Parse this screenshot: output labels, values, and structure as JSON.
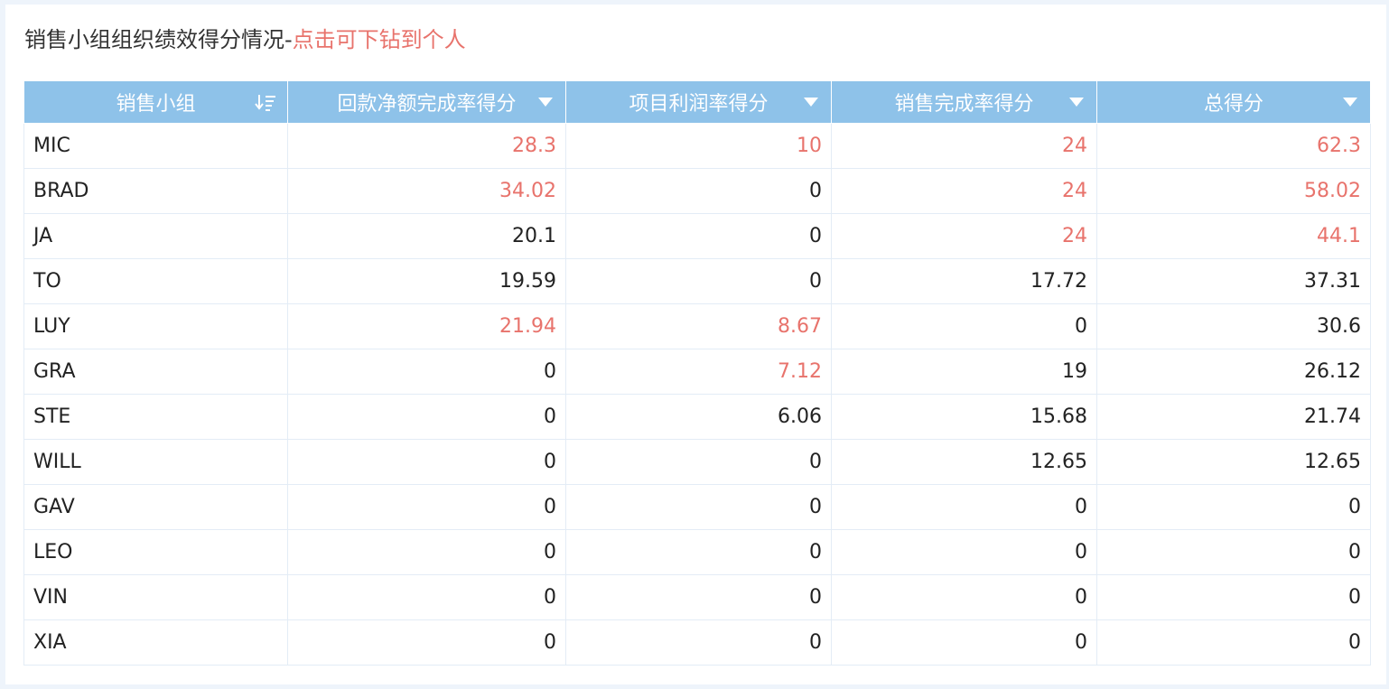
{
  "title": {
    "main": "销售小组组织绩效得分情况-",
    "hint": "点击可下钻到个人"
  },
  "colors": {
    "header_bg": "#8ec2e9",
    "highlight": "#e8736c"
  },
  "table": {
    "columns": [
      {
        "label": "销售小组",
        "icon": "sort-icon"
      },
      {
        "label": "回款净额完成率得分",
        "icon": "dropdown-icon"
      },
      {
        "label": "项目利润率得分",
        "icon": "dropdown-icon"
      },
      {
        "label": "销售完成率得分",
        "icon": "dropdown-icon"
      },
      {
        "label": "总得分",
        "icon": "dropdown-icon"
      }
    ],
    "rows": [
      {
        "name": "MIC",
        "values": [
          "28.3",
          "10",
          "24",
          "62.3"
        ],
        "highlight": [
          true,
          true,
          true,
          true
        ]
      },
      {
        "name": "BRAD",
        "values": [
          "34.02",
          "0",
          "24",
          "58.02"
        ],
        "highlight": [
          true,
          false,
          true,
          true
        ]
      },
      {
        "name": "JA",
        "values": [
          "20.1",
          "0",
          "24",
          "44.1"
        ],
        "highlight": [
          false,
          false,
          true,
          true
        ]
      },
      {
        "name": "TO",
        "values": [
          "19.59",
          "0",
          "17.72",
          "37.31"
        ],
        "highlight": [
          false,
          false,
          false,
          false
        ]
      },
      {
        "name": "LUY",
        "values": [
          "21.94",
          "8.67",
          "0",
          "30.6"
        ],
        "highlight": [
          true,
          true,
          false,
          false
        ]
      },
      {
        "name": "GRA",
        "values": [
          "0",
          "7.12",
          "19",
          "26.12"
        ],
        "highlight": [
          false,
          true,
          false,
          false
        ]
      },
      {
        "name": "STE",
        "values": [
          "0",
          "6.06",
          "15.68",
          "21.74"
        ],
        "highlight": [
          false,
          false,
          false,
          false
        ]
      },
      {
        "name": "WILL",
        "values": [
          "0",
          "0",
          "12.65",
          "12.65"
        ],
        "highlight": [
          false,
          false,
          false,
          false
        ]
      },
      {
        "name": "GAV",
        "values": [
          "0",
          "0",
          "0",
          "0"
        ],
        "highlight": [
          false,
          false,
          false,
          false
        ]
      },
      {
        "name": "LEO",
        "values": [
          "0",
          "0",
          "0",
          "0"
        ],
        "highlight": [
          false,
          false,
          false,
          false
        ]
      },
      {
        "name": "VIN",
        "values": [
          "0",
          "0",
          "0",
          "0"
        ],
        "highlight": [
          false,
          false,
          false,
          false
        ]
      },
      {
        "name": "XIA",
        "values": [
          "0",
          "0",
          "0",
          "0"
        ],
        "highlight": [
          false,
          false,
          false,
          false
        ]
      }
    ]
  }
}
